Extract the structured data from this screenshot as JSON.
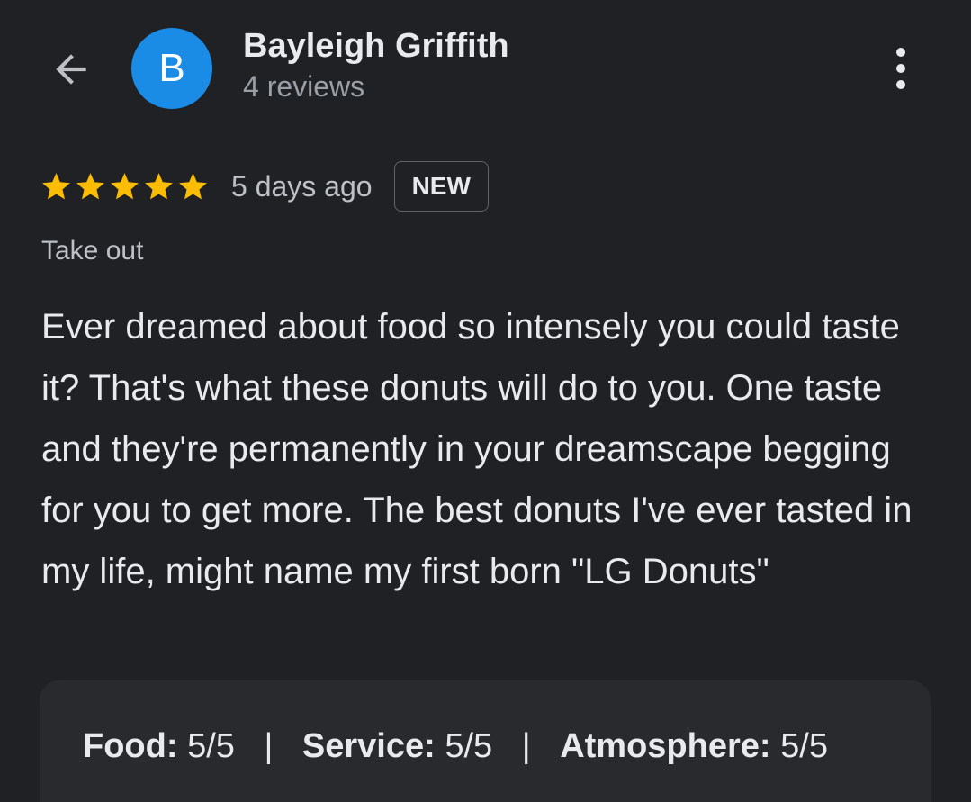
{
  "colors": {
    "background": "#202124",
    "avatar_bg": "#1a8ce6",
    "star": "#fbbc04",
    "card_bg": "#292a2d"
  },
  "header": {
    "back_icon": "arrow-left-icon",
    "avatar_letter": "B",
    "reviewer_name": "Bayleigh Griffith",
    "review_count": "4 reviews",
    "more_icon": "more-vert-icon"
  },
  "review": {
    "rating": 5,
    "max_rating": 5,
    "date": "5 days ago",
    "badge": "NEW",
    "service_type": "Take out",
    "text": "Ever dreamed about food so intensely you could taste it? That's what these donuts will do to you. One taste and they're permanently in your dreamscape begging for you to get more. The best donuts I've ever tasted in my life, might name my first born \"LG Donuts\""
  },
  "ratings": {
    "food_label": "Food:",
    "food_value": "5/5",
    "service_label": "Service:",
    "service_value": "5/5",
    "atmosphere_label": "Atmosphere:",
    "atmosphere_value": "5/5",
    "separator": "|"
  }
}
